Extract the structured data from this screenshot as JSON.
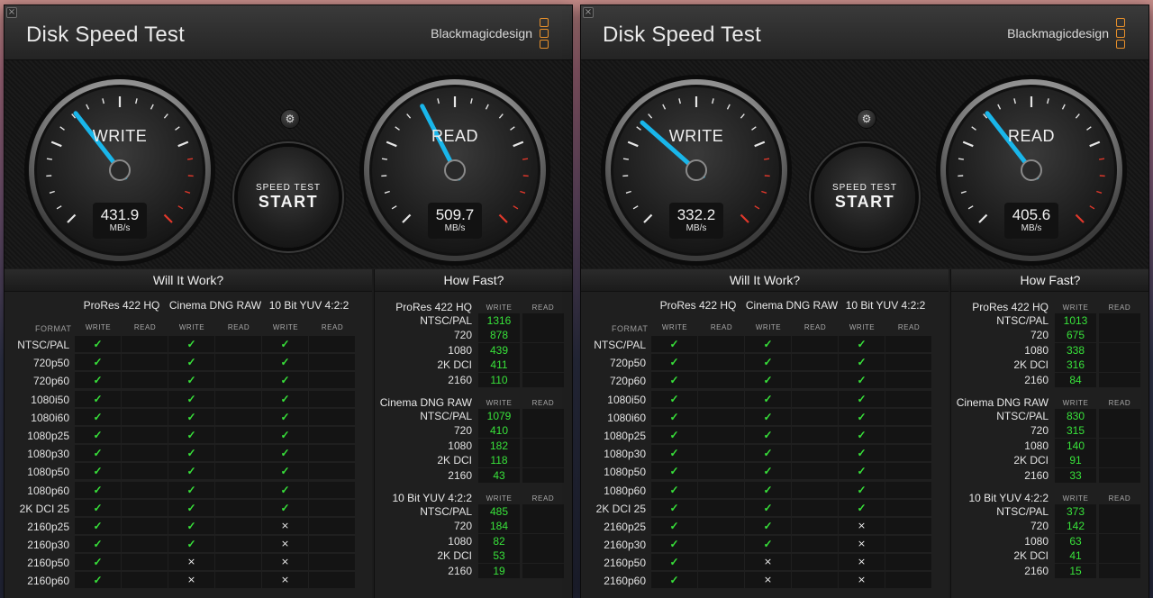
{
  "windows": [
    {
      "close_glyph": "×",
      "title": "Disk Speed Test",
      "brand": "Blackmagicdesign",
      "write": {
        "label": "WRITE",
        "value": "431.9",
        "unit": "MB/s",
        "needle_fraction": 0.36
      },
      "read": {
        "label": "READ",
        "value": "509.7",
        "unit": "MB/s",
        "needle_fraction": 0.4
      },
      "settings_glyph": "⚙",
      "start_button": {
        "line1": "SPEED TEST",
        "line2": "START"
      },
      "will_it_work": {
        "title": "Will It Work?",
        "format_header": "FORMAT",
        "codecs": [
          "ProRes 422 HQ",
          "Cinema DNG RAW",
          "10 Bit YUV 4:2:2"
        ],
        "sub_write": "WRITE",
        "sub_read": "READ",
        "rows": [
          {
            "format": "NTSC/PAL",
            "w": [
              "✓",
              "✓",
              "✓"
            ]
          },
          {
            "format": "720p50",
            "w": [
              "✓",
              "✓",
              "✓"
            ]
          },
          {
            "format": "720p60",
            "w": [
              "✓",
              "✓",
              "✓"
            ]
          },
          {
            "format": "1080i50",
            "w": [
              "✓",
              "✓",
              "✓"
            ]
          },
          {
            "format": "1080i60",
            "w": [
              "✓",
              "✓",
              "✓"
            ]
          },
          {
            "format": "1080p25",
            "w": [
              "✓",
              "✓",
              "✓"
            ]
          },
          {
            "format": "1080p30",
            "w": [
              "✓",
              "✓",
              "✓"
            ]
          },
          {
            "format": "1080p50",
            "w": [
              "✓",
              "✓",
              "✓"
            ]
          },
          {
            "format": "1080p60",
            "w": [
              "✓",
              "✓",
              "✓"
            ]
          },
          {
            "format": "2K DCI 25",
            "w": [
              "✓",
              "✓",
              "✓"
            ]
          },
          {
            "format": "2160p25",
            "w": [
              "✓",
              "✓",
              "×"
            ]
          },
          {
            "format": "2160p30",
            "w": [
              "✓",
              "✓",
              "×"
            ]
          },
          {
            "format": "2160p50",
            "w": [
              "✓",
              "×",
              "×"
            ]
          },
          {
            "format": "2160p60",
            "w": [
              "✓",
              "×",
              "×"
            ]
          }
        ]
      },
      "how_fast": {
        "title": "How Fast?",
        "sub_write": "WRITE",
        "sub_read": "READ",
        "groups": [
          {
            "name": "ProRes 422 HQ",
            "rows": [
              {
                "format": "NTSC/PAL",
                "write": "1316"
              },
              {
                "format": "720",
                "write": "878"
              },
              {
                "format": "1080",
                "write": "439"
              },
              {
                "format": "2K DCI",
                "write": "411"
              },
              {
                "format": "2160",
                "write": "110"
              }
            ]
          },
          {
            "name": "Cinema DNG RAW",
            "rows": [
              {
                "format": "NTSC/PAL",
                "write": "1079"
              },
              {
                "format": "720",
                "write": "410"
              },
              {
                "format": "1080",
                "write": "182"
              },
              {
                "format": "2K DCI",
                "write": "118"
              },
              {
                "format": "2160",
                "write": "43"
              }
            ]
          },
          {
            "name": "10 Bit YUV 4:2:2",
            "rows": [
              {
                "format": "NTSC/PAL",
                "write": "485"
              },
              {
                "format": "720",
                "write": "184"
              },
              {
                "format": "1080",
                "write": "82"
              },
              {
                "format": "2K DCI",
                "write": "53"
              },
              {
                "format": "2160",
                "write": "19"
              }
            ]
          }
        ]
      }
    },
    {
      "close_glyph": "×",
      "title": "Disk Speed Test",
      "brand": "Blackmagicdesign",
      "write": {
        "label": "WRITE",
        "value": "332.2",
        "unit": "MB/s",
        "needle_fraction": 0.32
      },
      "read": {
        "label": "READ",
        "value": "405.6",
        "unit": "MB/s",
        "needle_fraction": 0.36
      },
      "settings_glyph": "⚙",
      "start_button": {
        "line1": "SPEED TEST",
        "line2": "START"
      },
      "will_it_work": {
        "title": "Will It Work?",
        "format_header": "FORMAT",
        "codecs": [
          "ProRes 422 HQ",
          "Cinema DNG RAW",
          "10 Bit YUV 4:2:2"
        ],
        "sub_write": "WRITE",
        "sub_read": "READ",
        "rows": [
          {
            "format": "NTSC/PAL",
            "w": [
              "✓",
              "✓",
              "✓"
            ]
          },
          {
            "format": "720p50",
            "w": [
              "✓",
              "✓",
              "✓"
            ]
          },
          {
            "format": "720p60",
            "w": [
              "✓",
              "✓",
              "✓"
            ]
          },
          {
            "format": "1080i50",
            "w": [
              "✓",
              "✓",
              "✓"
            ]
          },
          {
            "format": "1080i60",
            "w": [
              "✓",
              "✓",
              "✓"
            ]
          },
          {
            "format": "1080p25",
            "w": [
              "✓",
              "✓",
              "✓"
            ]
          },
          {
            "format": "1080p30",
            "w": [
              "✓",
              "✓",
              "✓"
            ]
          },
          {
            "format": "1080p50",
            "w": [
              "✓",
              "✓",
              "✓"
            ]
          },
          {
            "format": "1080p60",
            "w": [
              "✓",
              "✓",
              "✓"
            ]
          },
          {
            "format": "2K DCI 25",
            "w": [
              "✓",
              "✓",
              "✓"
            ]
          },
          {
            "format": "2160p25",
            "w": [
              "✓",
              "✓",
              "×"
            ]
          },
          {
            "format": "2160p30",
            "w": [
              "✓",
              "✓",
              "×"
            ]
          },
          {
            "format": "2160p50",
            "w": [
              "✓",
              "×",
              "×"
            ]
          },
          {
            "format": "2160p60",
            "w": [
              "✓",
              "×",
              "×"
            ]
          }
        ]
      },
      "how_fast": {
        "title": "How Fast?",
        "sub_write": "WRITE",
        "sub_read": "READ",
        "groups": [
          {
            "name": "ProRes 422 HQ",
            "rows": [
              {
                "format": "NTSC/PAL",
                "write": "1013"
              },
              {
                "format": "720",
                "write": "675"
              },
              {
                "format": "1080",
                "write": "338"
              },
              {
                "format": "2K DCI",
                "write": "316"
              },
              {
                "format": "2160",
                "write": "84"
              }
            ]
          },
          {
            "name": "Cinema DNG RAW",
            "rows": [
              {
                "format": "NTSC/PAL",
                "write": "830"
              },
              {
                "format": "720",
                "write": "315"
              },
              {
                "format": "1080",
                "write": "140"
              },
              {
                "format": "2K DCI",
                "write": "91"
              },
              {
                "format": "2160",
                "write": "33"
              }
            ]
          },
          {
            "name": "10 Bit YUV 4:2:2",
            "rows": [
              {
                "format": "NTSC/PAL",
                "write": "373"
              },
              {
                "format": "720",
                "write": "142"
              },
              {
                "format": "1080",
                "write": "63"
              },
              {
                "format": "2K DCI",
                "write": "41"
              },
              {
                "format": "2160",
                "write": "15"
              }
            ]
          }
        ]
      }
    }
  ],
  "colors": {
    "needle": "#19b6ea",
    "ok": "#38e23a",
    "redline": "#e2382b",
    "brand_orange": "#e8902b"
  }
}
